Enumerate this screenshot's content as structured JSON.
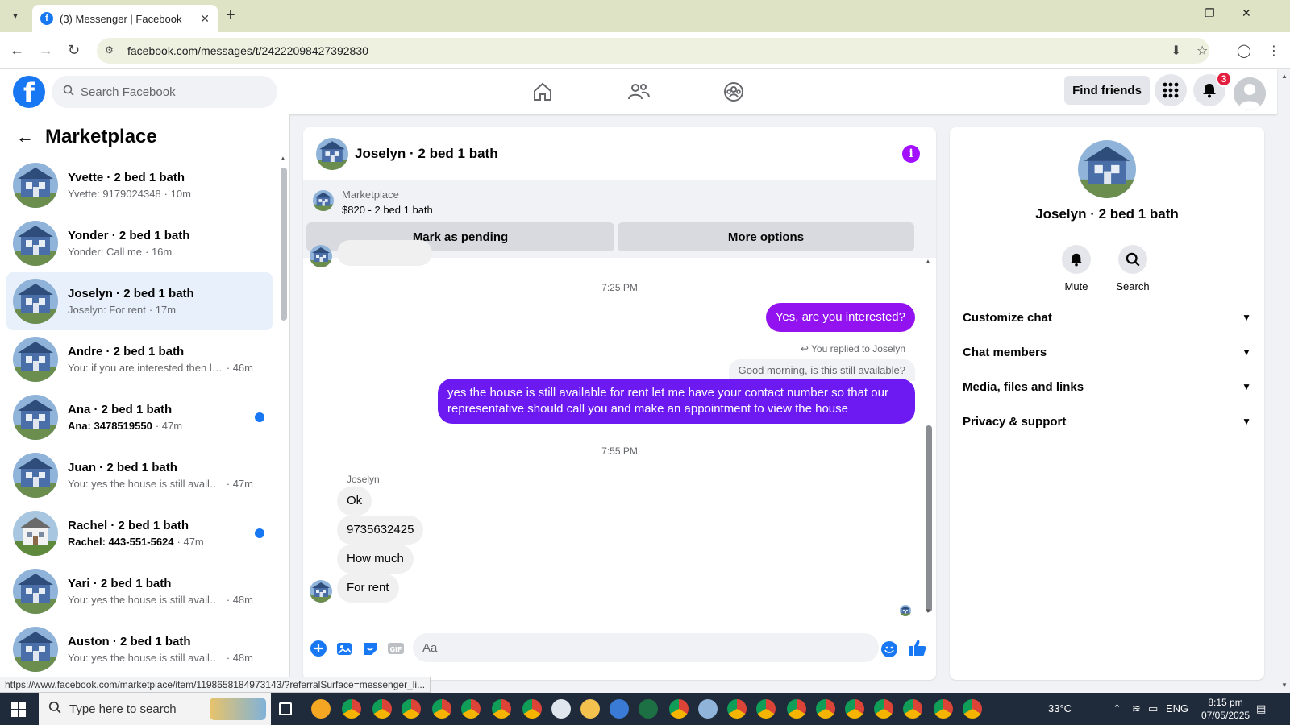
{
  "browser": {
    "tab_title": "(3) Messenger | Facebook",
    "url": "facebook.com/messages/t/24222098427392830",
    "status_url": "https://www.facebook.com/marketplace/item/1198658184973143/?referralSurface=messenger_li..."
  },
  "header": {
    "search_placeholder": "Search Facebook",
    "find_friends": "Find friends",
    "notif_count": "3"
  },
  "sidebar": {
    "title": "Marketplace",
    "conversations": [
      {
        "name": "Yvette · 2 bed 1 bath",
        "preview": "Yvette: 9179024348",
        "ago": "· 10m",
        "unread": false,
        "active": false
      },
      {
        "name": "Yonder · 2 bed 1 bath",
        "preview": "Yonder: Call me",
        "ago": "· 16m",
        "unread": false,
        "active": false
      },
      {
        "name": "Joselyn · 2 bed 1 bath",
        "preview": "Joselyn: For rent",
        "ago": "· 17m",
        "unread": false,
        "active": true
      },
      {
        "name": "Andre · 2 bed 1 bath",
        "preview": "You: if you are interested then let...",
        "ago": "· 46m",
        "unread": false,
        "active": false
      },
      {
        "name": "Ana · 2 bed 1 bath",
        "preview": "Ana: 3478519550",
        "ago": "· 47m",
        "unread": true,
        "active": false
      },
      {
        "name": "Juan · 2 bed 1 bath",
        "preview": "You: yes the house is still availabl...",
        "ago": "· 47m",
        "unread": false,
        "active": false
      },
      {
        "name": "Rachel · 2 bed 1 bath",
        "preview": "Rachel: 443-551-5624",
        "ago": "· 47m",
        "unread": true,
        "active": false
      },
      {
        "name": "Yari · 2 bed 1 bath",
        "preview": "You: yes the house is still availabl...",
        "ago": "· 48m",
        "unread": false,
        "active": false
      },
      {
        "name": "Auston · 2 bed 1 bath",
        "preview": "You: yes the house is still availabl...",
        "ago": "· 48m",
        "unread": false,
        "active": false
      }
    ]
  },
  "chat": {
    "title": "Joselyn · 2 bed 1 bath",
    "marketplace_label": "Marketplace",
    "listing": "$820 - 2 bed 1 bath",
    "mark_pending": "Mark as pending",
    "more_options": "More options",
    "time1": "7:25 PM",
    "msg_out1": "Yes, are you interested?",
    "replied_to": "You replied to Joselyn",
    "quoted": "Good morning, is this still available?",
    "msg_out2": "yes the house is still available for rent let me have your contact number so that our representative should call you and make an appointment to view the house",
    "time2": "7:55 PM",
    "sender": "Joselyn",
    "msg_in1": "Ok",
    "msg_in2": "9735632425",
    "msg_in3": "How much",
    "msg_in4": "For rent",
    "composer_placeholder": "Aa"
  },
  "details": {
    "name": "Joselyn · 2 bed 1 bath",
    "mute": "Mute",
    "search": "Search",
    "sections": [
      "Customize chat",
      "Chat members",
      "Media, files and links",
      "Privacy & support"
    ]
  },
  "taskbar": {
    "search_placeholder": "Type here to search",
    "temp": "33°C",
    "lang": "ENG",
    "time": "8:15 pm",
    "date": "07/05/2025"
  },
  "colors": {
    "brand": "#1877f2",
    "accent": "#9213f0",
    "unread_dot": "#1877f2"
  }
}
